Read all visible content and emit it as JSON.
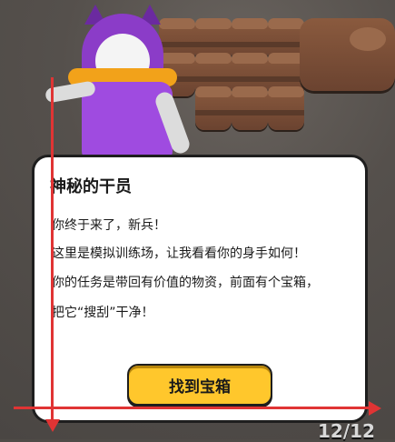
{
  "dialog": {
    "title": "神秘的干员",
    "lines": [
      "你终于来了，新兵！",
      "这里是模拟训练场，让我看看你的身手如何！",
      "你的任务是带回有价值的物资，前面有个宝箱，",
      "把它“搜刮”干净！"
    ],
    "button_label": "找到宝箱"
  },
  "hud": {
    "counter": "12/12"
  },
  "colors": {
    "accent_button": "#ffc72c",
    "annotation_arrow": "#e03434"
  }
}
